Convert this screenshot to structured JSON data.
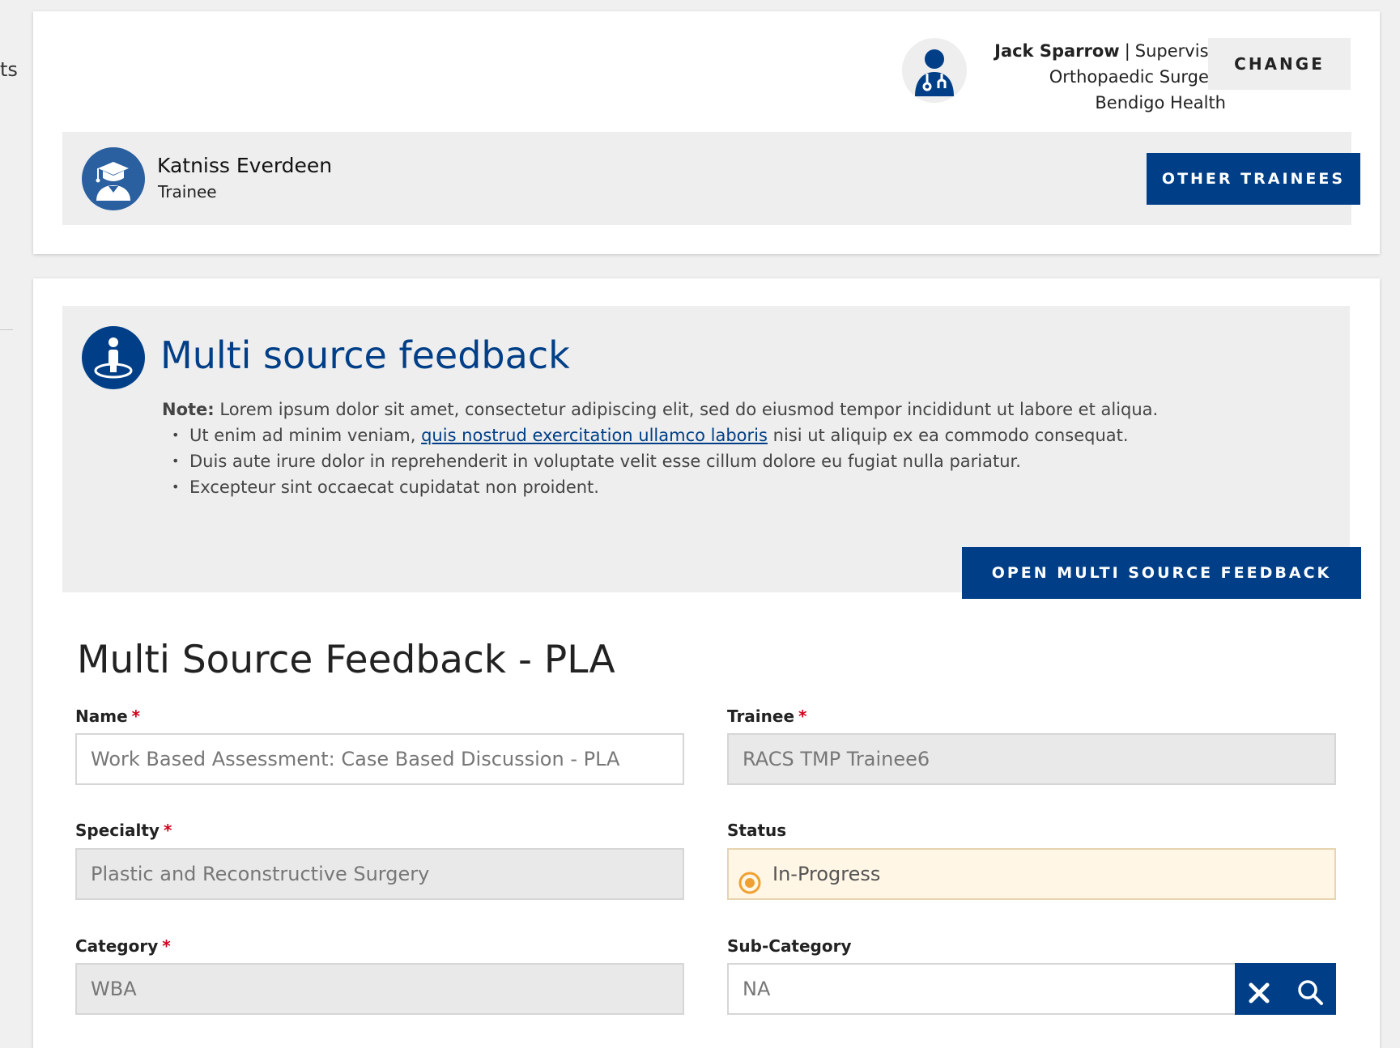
{
  "edge": {
    "partial_text": "ts"
  },
  "supervisor": {
    "name": "Jack Sparrow",
    "separator": "|",
    "role": "Supervisor",
    "specialty": "Orthopaedic Surgery",
    "hospital": "Bendigo Health",
    "change_label": "CHANGE",
    "avatar_icon": "doctor-stethoscope-icon"
  },
  "trainee": {
    "name": "Katniss Everdeen",
    "role": "Trainee",
    "other_label": "OTHER TRAINEES",
    "avatar_icon": "graduate-icon"
  },
  "info": {
    "icon": "person-on-platform-icon",
    "title": "Multi source feedback",
    "note_label": "Note:",
    "note_text": " Lorem ipsum dolor sit amet, consectetur adipiscing elit, sed do eiusmod tempor incididunt ut labore et aliqua.",
    "bullet1_before": "Ut enim ad minim veniam, ",
    "bullet1_link": "quis nostrud exercitation ullamco laboris",
    "bullet1_after": " nisi ut aliquip ex ea commodo consequat.",
    "bullet2": "Duis aute irure dolor in reprehenderit in voluptate velit esse cillum dolore eu fugiat nulla pariatur.",
    "bullet3": "Excepteur sint occaecat cupidatat non proident.",
    "open_label": "OPEN MULTI SOURCE FEEDBACK"
  },
  "form": {
    "title": "Multi Source Feedback - PLA",
    "required_marker": "*",
    "name_label": "Name",
    "name_value": "Work Based Assessment: Case Based Discussion - PLA",
    "trainee_label": "Trainee",
    "trainee_value": "RACS TMP Trainee6",
    "specialty_label": "Specialty",
    "specialty_value": "Plastic and Reconstructive Surgery",
    "status_label": "Status",
    "status_value": "In-Progress",
    "category_label": "Category",
    "category_value": "WBA",
    "subcategory_label": "Sub-Category",
    "subcategory_value": "NA"
  },
  "colors": {
    "brand": "#003f87",
    "required": "#d0021b",
    "status_bg": "#fff6e5",
    "status_icon": "#f0a030"
  }
}
